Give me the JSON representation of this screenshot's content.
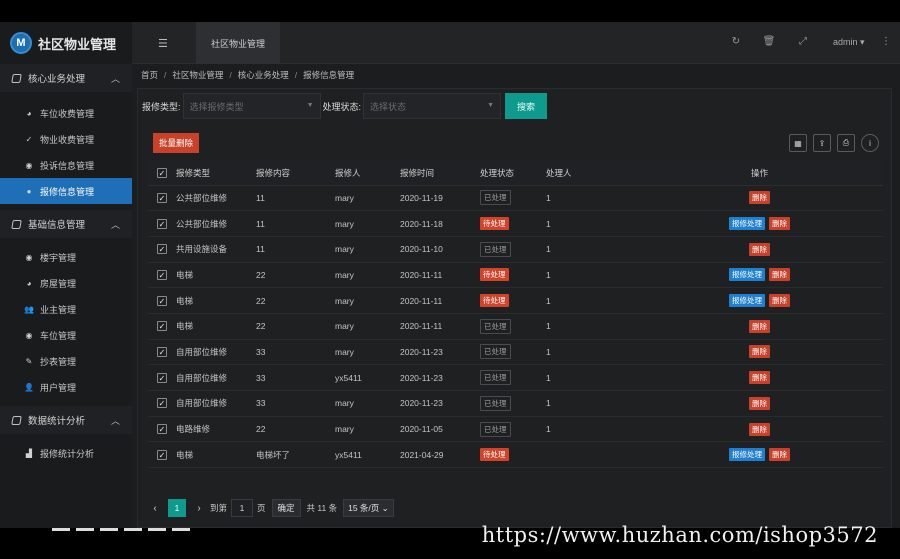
{
  "app": {
    "title": "社区物业管理",
    "logo_letter": "M"
  },
  "header": {
    "open_tab": "社区物业管理",
    "user": "admin",
    "icons": [
      "refresh-icon",
      "trash-icon",
      "fullscreen-icon",
      "more-vertical-icon"
    ]
  },
  "sidebar": {
    "groups": [
      {
        "label": "核心业务处理",
        "items": [
          {
            "label": "车位收费管理",
            "icon": "dashboard-icon"
          },
          {
            "label": "物业收费管理",
            "icon": "chevron-icon"
          },
          {
            "label": "投诉信息管理",
            "icon": "target-icon"
          },
          {
            "label": "报修信息管理",
            "icon": "target-icon",
            "active": true
          }
        ]
      },
      {
        "label": "基础信息管理",
        "items": [
          {
            "label": "楼宇管理",
            "icon": "target-icon"
          },
          {
            "label": "房屋管理",
            "icon": "dashboard-icon"
          },
          {
            "label": "业主管理",
            "icon": "users-icon"
          },
          {
            "label": "车位管理",
            "icon": "target-icon"
          },
          {
            "label": "抄表管理",
            "icon": "edit-icon"
          },
          {
            "label": "用户管理",
            "icon": "user-icon"
          }
        ]
      },
      {
        "label": "数据统计分析",
        "items": [
          {
            "label": "报修统计分析",
            "icon": "area-chart-icon"
          }
        ]
      }
    ]
  },
  "breadcrumb": [
    "首页",
    "社区物业管理",
    "核心业务处理",
    "报修信息管理"
  ],
  "filters": {
    "type_label": "报修类型:",
    "type_placeholder": "选择报修类型",
    "status_label": "处理状态:",
    "status_placeholder": "选择状态",
    "search_label": "搜索"
  },
  "toolbar": {
    "batch_delete_label": "批量删除"
  },
  "table": {
    "headers": [
      "报修类型",
      "报修内容",
      "报修人",
      "报修时间",
      "处理状态",
      "处理人",
      "操作"
    ],
    "handle_label": "报修处理",
    "delete_label": "删除",
    "rows": [
      {
        "type": "公共部位维修",
        "content": "11",
        "reporter": "mary",
        "time": "2020-11-19",
        "status": "已处理",
        "pending": false,
        "handler": "1"
      },
      {
        "type": "公共部位维修",
        "content": "11",
        "reporter": "mary",
        "time": "2020-11-18",
        "status": "待处理",
        "pending": true,
        "handler": "1"
      },
      {
        "type": "共用设施设备",
        "content": "11",
        "reporter": "mary",
        "time": "2020-11-10",
        "status": "已处理",
        "pending": false,
        "handler": "1"
      },
      {
        "type": "电梯",
        "content": "22",
        "reporter": "mary",
        "time": "2020-11-11",
        "status": "待处理",
        "pending": true,
        "handler": "1"
      },
      {
        "type": "电梯",
        "content": "22",
        "reporter": "mary",
        "time": "2020-11-11",
        "status": "待处理",
        "pending": true,
        "handler": "1"
      },
      {
        "type": "电梯",
        "content": "22",
        "reporter": "mary",
        "time": "2020-11-11",
        "status": "已处理",
        "pending": false,
        "handler": "1"
      },
      {
        "type": "自用部位维修",
        "content": "33",
        "reporter": "mary",
        "time": "2020-11-23",
        "status": "已处理",
        "pending": false,
        "handler": "1"
      },
      {
        "type": "自用部位维修",
        "content": "33",
        "reporter": "yx5411",
        "time": "2020-11-23",
        "status": "已处理",
        "pending": false,
        "handler": "1"
      },
      {
        "type": "自用部位维修",
        "content": "33",
        "reporter": "mary",
        "time": "2020-11-23",
        "status": "已处理",
        "pending": false,
        "handler": "1"
      },
      {
        "type": "电路维修",
        "content": "22",
        "reporter": "mary",
        "time": "2020-11-05",
        "status": "已处理",
        "pending": false,
        "handler": "1"
      },
      {
        "type": "电梯",
        "content": "电梯坏了",
        "reporter": "yx5411",
        "time": "2021-04-29",
        "status": "待处理",
        "pending": true,
        "handler": ""
      }
    ]
  },
  "pager": {
    "current": "1",
    "goto_label": "到第",
    "goto_value": "1",
    "page_unit": "页",
    "confirm_label": "确定",
    "total": "共 11 条",
    "page_size": "15 条/页"
  },
  "watermark": "https://www.huzhan.com/ishop3572"
}
